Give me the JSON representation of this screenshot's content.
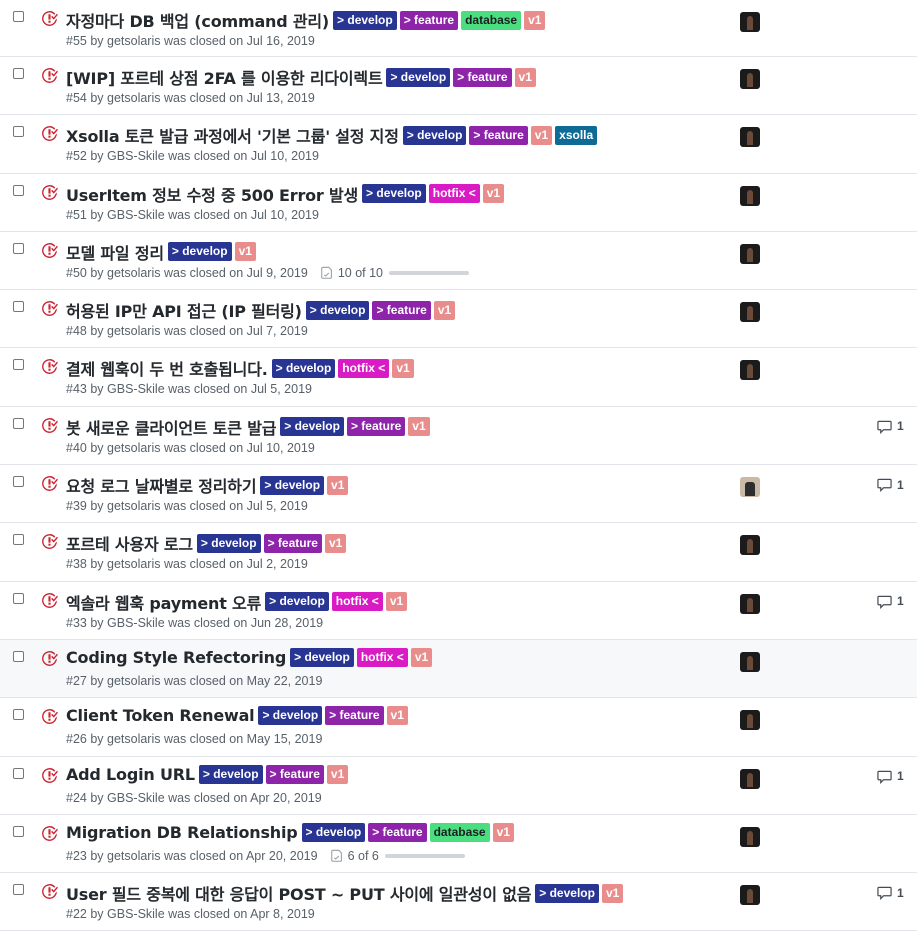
{
  "colors": {
    "develop": "#283593",
    "feature": "#8e24aa",
    "database": "#4ade80",
    "v1": "#e88c8c",
    "hotfix": "#d81bc4",
    "xsolla": "#0e6b96",
    "closed_icon": "#cb2431"
  },
  "issues": [
    {
      "title": "자정마다 DB 백업 (command 관리)",
      "labels": [
        {
          "text": "> develop",
          "kind": "develop"
        },
        {
          "text": "> feature",
          "kind": "feature"
        },
        {
          "text": "database",
          "kind": "database"
        },
        {
          "text": "v1",
          "kind": "v1"
        }
      ],
      "meta": "#55 by getsolaris was closed on Jul 16, 2019",
      "avatar": "dark",
      "comments": ""
    },
    {
      "title": "[WIP] 포르테 상점 2FA 를 이용한 리다이렉트",
      "labels": [
        {
          "text": "> develop",
          "kind": "develop"
        },
        {
          "text": "> feature",
          "kind": "feature"
        },
        {
          "text": "v1",
          "kind": "v1"
        }
      ],
      "meta": "#54 by getsolaris was closed on Jul 13, 2019",
      "avatar": "dark",
      "comments": ""
    },
    {
      "title": "Xsolla 토큰 발급 과정에서 '기본 그룹' 설정 지정",
      "labels": [
        {
          "text": "> develop",
          "kind": "develop"
        },
        {
          "text": "> feature",
          "kind": "feature"
        },
        {
          "text": "v1",
          "kind": "v1"
        },
        {
          "text": "xsolla",
          "kind": "xsolla"
        }
      ],
      "meta": "#52 by GBS-Skile was closed on Jul 10, 2019",
      "avatar": "dark",
      "comments": ""
    },
    {
      "title": "UserItem 정보 수정 중 500 Error 발생",
      "labels": [
        {
          "text": "> develop",
          "kind": "develop"
        },
        {
          "text": "hotfix <",
          "kind": "hotfix"
        },
        {
          "text": "v1",
          "kind": "v1"
        }
      ],
      "meta": "#51 by GBS-Skile was closed on Jul 10, 2019",
      "avatar": "dark",
      "comments": ""
    },
    {
      "title": "모델 파일 정리",
      "labels": [
        {
          "text": "> develop",
          "kind": "develop"
        },
        {
          "text": "v1",
          "kind": "v1"
        }
      ],
      "meta": "#50 by getsolaris was closed on Jul 9, 2019",
      "task": "10 of 10",
      "avatar": "dark",
      "comments": ""
    },
    {
      "title": "허용된 IP만 API 접근 (IP 필터링)",
      "labels": [
        {
          "text": "> develop",
          "kind": "develop"
        },
        {
          "text": "> feature",
          "kind": "feature"
        },
        {
          "text": "v1",
          "kind": "v1"
        }
      ],
      "meta": "#48 by getsolaris was closed on Jul 7, 2019",
      "avatar": "dark",
      "comments": ""
    },
    {
      "title": "결제 웹훅이 두 번 호출됩니다.",
      "labels": [
        {
          "text": "> develop",
          "kind": "develop"
        },
        {
          "text": "hotfix <",
          "kind": "hotfix"
        },
        {
          "text": "v1",
          "kind": "v1"
        }
      ],
      "meta": "#43 by GBS-Skile was closed on Jul 5, 2019",
      "avatar": "dark",
      "comments": ""
    },
    {
      "title": "봇 새로운 클라이언트 토큰 발급",
      "labels": [
        {
          "text": "> develop",
          "kind": "develop"
        },
        {
          "text": "> feature",
          "kind": "feature"
        },
        {
          "text": "v1",
          "kind": "v1"
        }
      ],
      "meta": "#40 by getsolaris was closed on Jul 10, 2019",
      "avatar": "",
      "comments": "1"
    },
    {
      "title": "요청 로그 날짜별로 정리하기",
      "labels": [
        {
          "text": "> develop",
          "kind": "develop"
        },
        {
          "text": "v1",
          "kind": "v1"
        }
      ],
      "meta": "#39 by getsolaris was closed on Jul 5, 2019",
      "avatar": "alt",
      "comments": "1"
    },
    {
      "title": "포르테 사용자 로그",
      "labels": [
        {
          "text": "> develop",
          "kind": "develop"
        },
        {
          "text": "> feature",
          "kind": "feature"
        },
        {
          "text": "v1",
          "kind": "v1"
        }
      ],
      "meta": "#38 by getsolaris was closed on Jul 2, 2019",
      "avatar": "dark",
      "comments": ""
    },
    {
      "title": "엑솔라 웹훅 payment 오류",
      "labels": [
        {
          "text": "> develop",
          "kind": "develop"
        },
        {
          "text": "hotfix <",
          "kind": "hotfix"
        },
        {
          "text": "v1",
          "kind": "v1"
        }
      ],
      "meta": "#33 by GBS-Skile was closed on Jun 28, 2019",
      "avatar": "dark",
      "comments": "1"
    },
    {
      "title": "Coding Style Refectoring",
      "labels": [
        {
          "text": "> develop",
          "kind": "develop"
        },
        {
          "text": "hotfix <",
          "kind": "hotfix"
        },
        {
          "text": "v1",
          "kind": "v1"
        }
      ],
      "meta": "#27 by getsolaris was closed on May 22, 2019",
      "avatar": "dark",
      "comments": "",
      "hover": true
    },
    {
      "title": "Client Token Renewal",
      "labels": [
        {
          "text": "> develop",
          "kind": "develop"
        },
        {
          "text": "> feature",
          "kind": "feature"
        },
        {
          "text": "v1",
          "kind": "v1"
        }
      ],
      "meta": "#26 by getsolaris was closed on May 15, 2019",
      "avatar": "dark",
      "comments": ""
    },
    {
      "title": "Add Login URL",
      "labels": [
        {
          "text": "> develop",
          "kind": "develop"
        },
        {
          "text": "> feature",
          "kind": "feature"
        },
        {
          "text": "v1",
          "kind": "v1"
        }
      ],
      "meta": "#24 by GBS-Skile was closed on Apr 20, 2019",
      "avatar": "dark",
      "comments": "1"
    },
    {
      "title": "Migration DB Relationship",
      "labels": [
        {
          "text": "> develop",
          "kind": "develop"
        },
        {
          "text": "> feature",
          "kind": "feature"
        },
        {
          "text": "database",
          "kind": "database"
        },
        {
          "text": "v1",
          "kind": "v1"
        }
      ],
      "meta": "#23 by getsolaris was closed on Apr 20, 2019",
      "task": "6 of 6",
      "avatar": "dark",
      "comments": ""
    },
    {
      "title": "User 필드 중복에 대한 응답이 POST ~ PUT 사이에 일관성이 없음",
      "labels": [
        {
          "text": "> develop",
          "kind": "develop"
        },
        {
          "text": "v1",
          "kind": "v1"
        }
      ],
      "meta": "#22 by GBS-Skile was closed on Apr 8, 2019",
      "avatar": "dark",
      "comments": "1"
    }
  ]
}
